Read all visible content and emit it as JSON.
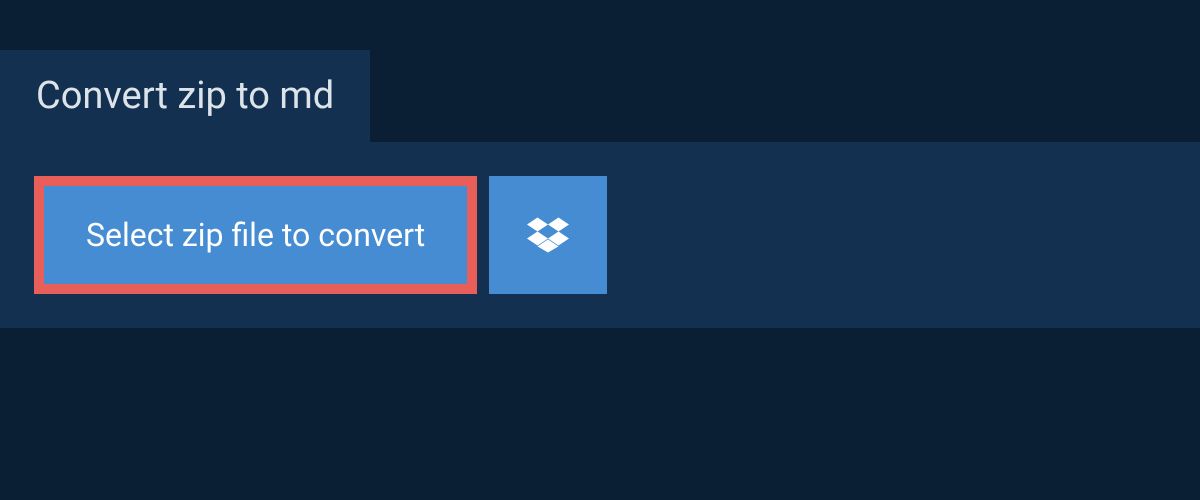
{
  "header": {
    "title": "Convert zip to md"
  },
  "actions": {
    "select_file_label": "Select zip file to convert",
    "dropbox_icon": "dropbox-icon"
  },
  "colors": {
    "background": "#0a1f33",
    "panel": "#143050",
    "button": "#468cd3",
    "highlight_border": "#e85f5a",
    "text_light": "#dce4ea",
    "button_text": "#ffffff"
  }
}
